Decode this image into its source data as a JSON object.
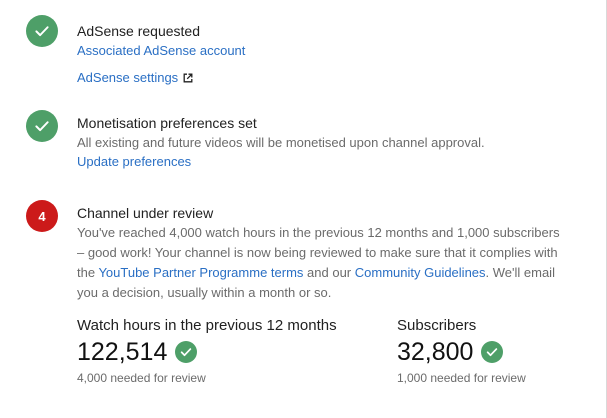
{
  "steps": {
    "adsense": {
      "title": "AdSense requested",
      "link_account": "Associated AdSense account",
      "link_settings": "AdSense settings",
      "status_icon": "check-icon"
    },
    "monetisation": {
      "title": "Monetisation preferences set",
      "description": "All existing and future videos will be monetised upon channel approval.",
      "link_update": "Update preferences",
      "status_icon": "check-icon"
    },
    "review": {
      "step_number": "4",
      "title": "Channel under review",
      "desc_part1": "You've reached 4,000 watch hours in the previous 12 months and 1,000 subscribers – good work! Your channel is now being reviewed to make sure that it complies with the ",
      "link_partner_terms": "YouTube Partner Programme terms",
      "desc_part2": " and our ",
      "link_community": "Community Guidelines",
      "desc_part3": ". We'll email you a decision, usually within a month or so."
    }
  },
  "stats": {
    "watch_hours": {
      "label": "Watch hours in the previous 12 months",
      "value": "122,514",
      "note": "4,000 needed for review"
    },
    "subscribers": {
      "label": "Subscribers",
      "value": "32,800",
      "note": "1,000 needed for review"
    }
  },
  "colors": {
    "success_green": "#4e9f68",
    "pending_red": "#cc1a1a",
    "link_blue": "#2a6fc4",
    "muted_text": "#6b6b6b"
  }
}
